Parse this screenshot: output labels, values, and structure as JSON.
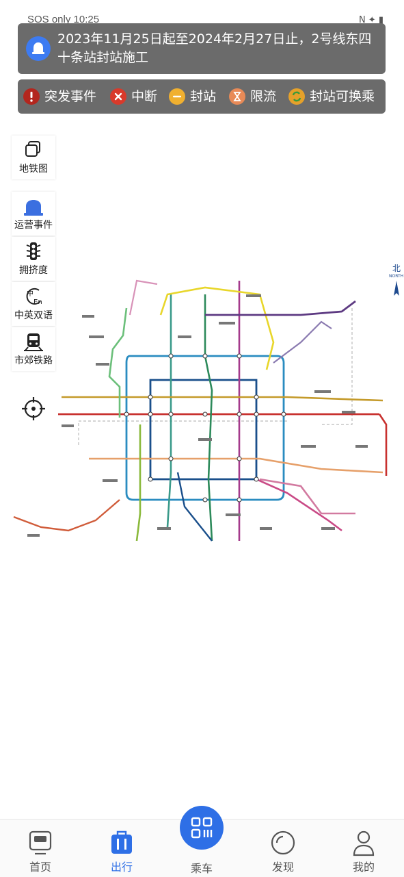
{
  "status_bar": {
    "left_text": "SOS only 10:25",
    "right_text": "N ✦ ▮"
  },
  "notice": {
    "text": "2023年11月25日起至2024年2月27日止，2号线东四十条站封站施工",
    "icon": "bell-icon",
    "icon_color": "#3d7bf2"
  },
  "legend": {
    "items": [
      {
        "label": "突发事件",
        "icon": "exclamation-icon",
        "color": "#b3261e"
      },
      {
        "label": "中断",
        "icon": "cross-icon",
        "color": "#d93a2b"
      },
      {
        "label": "封站",
        "icon": "minus-icon",
        "color": "#f0b030"
      },
      {
        "label": "限流",
        "icon": "hourglass-icon",
        "color": "#e88a57"
      },
      {
        "label": "封站可换乘",
        "icon": "swap-icon",
        "color": "#e5a12a"
      }
    ]
  },
  "tools": [
    {
      "label": "地铁图",
      "icon": "copy-icon"
    },
    {
      "label": "运营事件",
      "icon": "alarm-icon"
    },
    {
      "label": "拥挤度",
      "icon": "traffic-light-icon"
    },
    {
      "label": "中英双语",
      "icon": "language-icon"
    },
    {
      "label": "市郊铁路",
      "icon": "train-icon"
    }
  ],
  "map": {
    "north_label": "北",
    "north_sub": "NORTH"
  },
  "nav": {
    "items": [
      {
        "label": "首页",
        "icon": "home-tv-icon",
        "active": false
      },
      {
        "label": "出行",
        "icon": "bag-icon",
        "active": true
      },
      {
        "label": "乘车",
        "icon": "qr-code-icon",
        "active": false
      },
      {
        "label": "发现",
        "icon": "discover-icon",
        "active": false
      },
      {
        "label": "我的",
        "icon": "user-icon",
        "active": false
      }
    ],
    "active_color": "#2e6fe6"
  }
}
